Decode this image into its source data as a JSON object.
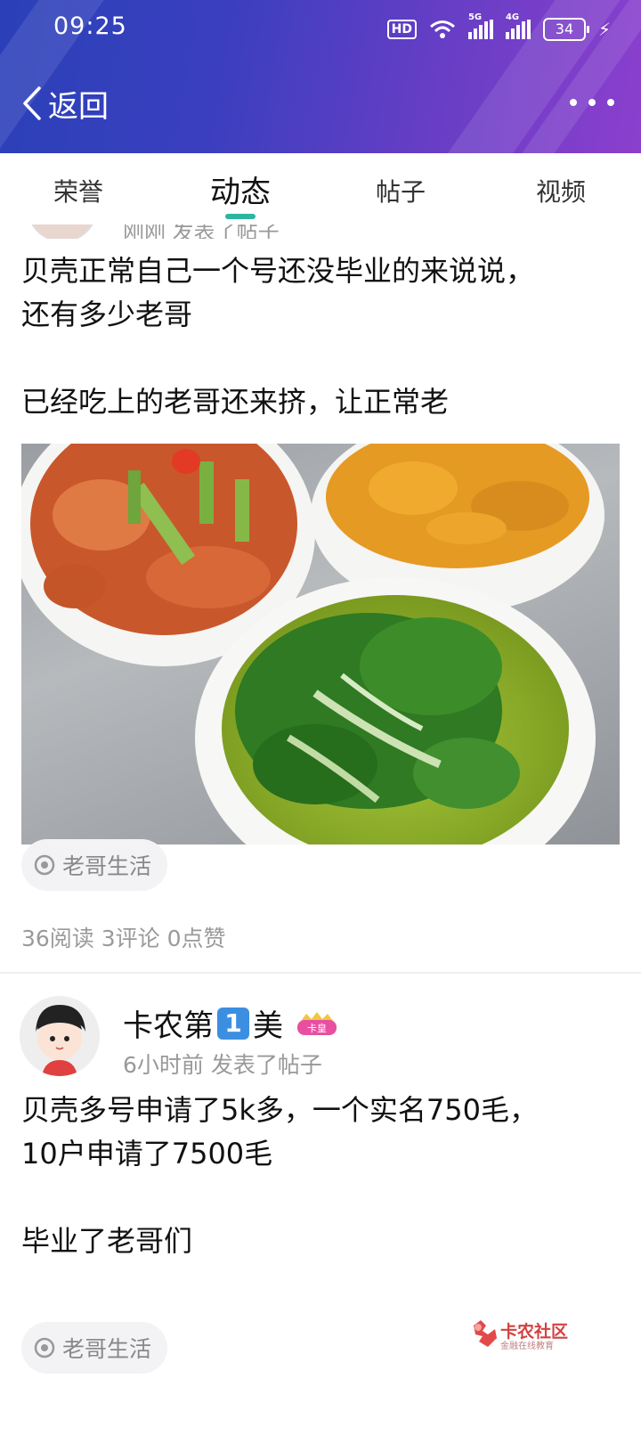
{
  "status_bar": {
    "time": "09:25",
    "hd_label": "HD",
    "net1": "5G",
    "net2": "4G",
    "battery": "34"
  },
  "header": {
    "back_label": "返回"
  },
  "tabs": [
    {
      "label": "荣誉"
    },
    {
      "label": "动态"
    },
    {
      "label": "帖子"
    },
    {
      "label": "视频"
    }
  ],
  "active_tab": "动态",
  "posts": [
    {
      "meta": "刚刚  发表了帖子",
      "text": "贝壳正常自己一个号还没毕业的来说说，\n还有多少老哥\n\n已经吃上的老哥还来挤，让正常老",
      "tag": "老哥生活",
      "stats": "36阅读 3评论 0点赞"
    },
    {
      "author": "卡农第",
      "author_num": "1",
      "author_suffix": "美",
      "badge": "卡皇",
      "meta": "6小时前  发表了帖子",
      "text": "贝壳多号申请了5k多，一个实名750毛，\n10户申请了7500毛\n\n毕业了老哥们",
      "tag": "老哥生活"
    }
  ],
  "watermark": {
    "title": "卡农社区",
    "subtitle": "金融在线教育"
  },
  "colors": {
    "header_start": "#2a40b8",
    "header_end": "#8b3fcd",
    "tab_indicator": "#2db5a1"
  }
}
